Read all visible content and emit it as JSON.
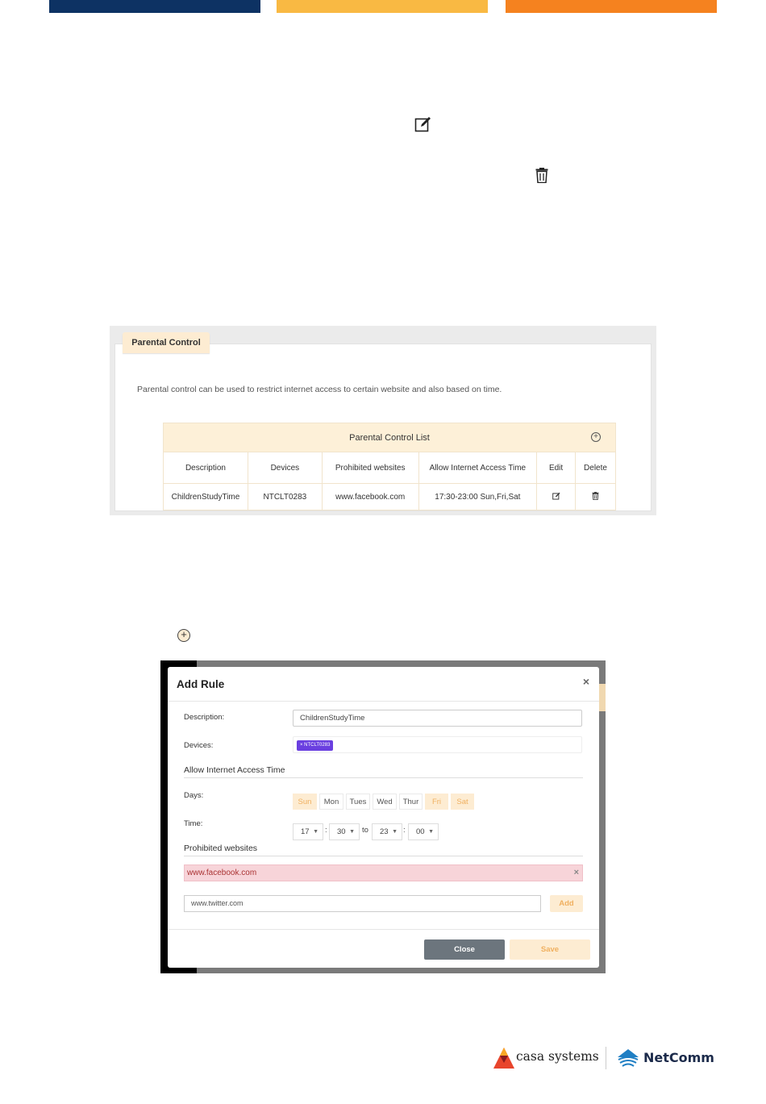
{
  "colors": {
    "bar_navy": "#0d3263",
    "bar_yellow": "#f9b943",
    "bar_orange": "#f5821f",
    "accent_light": "#fdecd2",
    "device_chip": "#6a3fe0"
  },
  "icons": {
    "edit": "edit-icon",
    "delete": "trash-icon",
    "add": "plus-circle-icon"
  },
  "panel": {
    "tab_label": "Parental Control",
    "description": "Parental control can be used to restrict internet access to certain website and also based on time.",
    "table_title": "Parental Control List",
    "columns": [
      "Description",
      "Devices",
      "Prohibited websites",
      "Allow Internet Access Time",
      "Edit",
      "Delete"
    ],
    "row": {
      "description": "ChildrenStudyTime",
      "devices": "NTCLT0283",
      "websites": "www.facebook.com",
      "time": "17:30-23:00 Sun,Fri,Sat"
    }
  },
  "modal": {
    "title": "Add Rule",
    "close_symbol": "×",
    "description_label": "Description:",
    "description_value": "ChildrenStudyTime",
    "devices_label": "Devices:",
    "device_chip": "× NTCLT0283",
    "access_time_heading": "Allow Internet Access Time",
    "days_label": "Days:",
    "days": [
      "Sun",
      "Mon",
      "Tues",
      "Wed",
      "Thur",
      "Fri",
      "Sat"
    ],
    "time_label": "Time:",
    "time": {
      "start_hour": "17",
      "start_min": "30",
      "to": "to",
      "end_hour": "23",
      "end_min": "00",
      "colon": ":"
    },
    "websites_heading": "Prohibited websites",
    "blocked_site": "www.facebook.com",
    "remove_symbol": "×",
    "site_input_value": "www.twitter.com",
    "add_label": "Add",
    "close_label": "Close",
    "save_label": "Save"
  },
  "footer": {
    "casa_brand": "casa systems",
    "netcomm_brand": "NetComm"
  }
}
